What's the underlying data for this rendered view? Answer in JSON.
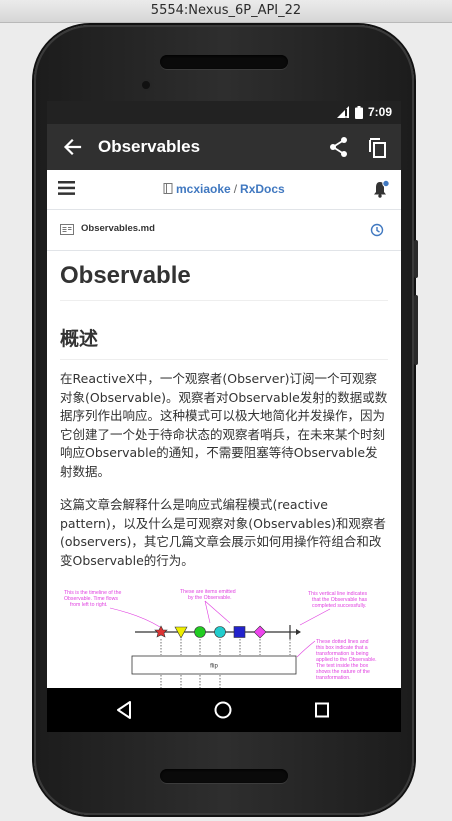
{
  "window": {
    "title": "5554:Nexus_6P_API_22"
  },
  "status_bar": {
    "time": "7:09",
    "colors": {
      "bar": "#222222"
    }
  },
  "app_bar": {
    "title": "Observables",
    "back_icon": "arrow-back-icon",
    "share_icon": "share-icon",
    "copy_icon": "copy-icon"
  },
  "github_header": {
    "menu_icon": "hamburger-menu-icon",
    "owner": "mcxiaoke",
    "separator": "/",
    "repo": "RxDocs",
    "bell_icon": "notification-bell-icon"
  },
  "file": {
    "name": "Observables.md",
    "icon": "file-icon",
    "history_icon": "history-icon"
  },
  "article": {
    "h1": "Observable",
    "h2": "概述",
    "p1": "在ReactiveX中，一个观察者(Observer)订阅一个可观察对象(Observable)。观察者对Observable发射的数据或数据序列作出响应。这种模式可以极大地简化并发操作，因为它创建了一个处于待命状态的观察者哨兵，在未来某个时刻响应Observable的通知，不需要阻塞等待Observable发射数据。",
    "p2": "这篇文章会解释什么是响应式编程模式(reactive pattern)，以及什么是可观察对象(Observables)和观察者(observers)，其它几篇文章会展示如何用操作符组合和改变Observable的行为。"
  },
  "diagram": {
    "note_left": [
      "This is the timeline of the",
      "Observable. Time flows",
      "from left to right."
    ],
    "note_top": [
      "These are items emitted",
      "by the Observable."
    ],
    "note_right": [
      "This vertical line indicates",
      "that the Observable has",
      "completed successfully."
    ],
    "note_right2": [
      "These dotted lines and",
      "this box indicate that a",
      "transformation is being",
      "applied to the Observable.",
      "The text inside the box",
      "shows the nature of the",
      "transformation."
    ],
    "box_label": "flip"
  },
  "nav_bar": {
    "back_icon": "nav-back-icon",
    "home_icon": "nav-home-icon",
    "recents_icon": "nav-recents-icon"
  },
  "colors": {
    "link": "#4078c0",
    "appbar": "#303030",
    "annotation": "#e040e0"
  }
}
